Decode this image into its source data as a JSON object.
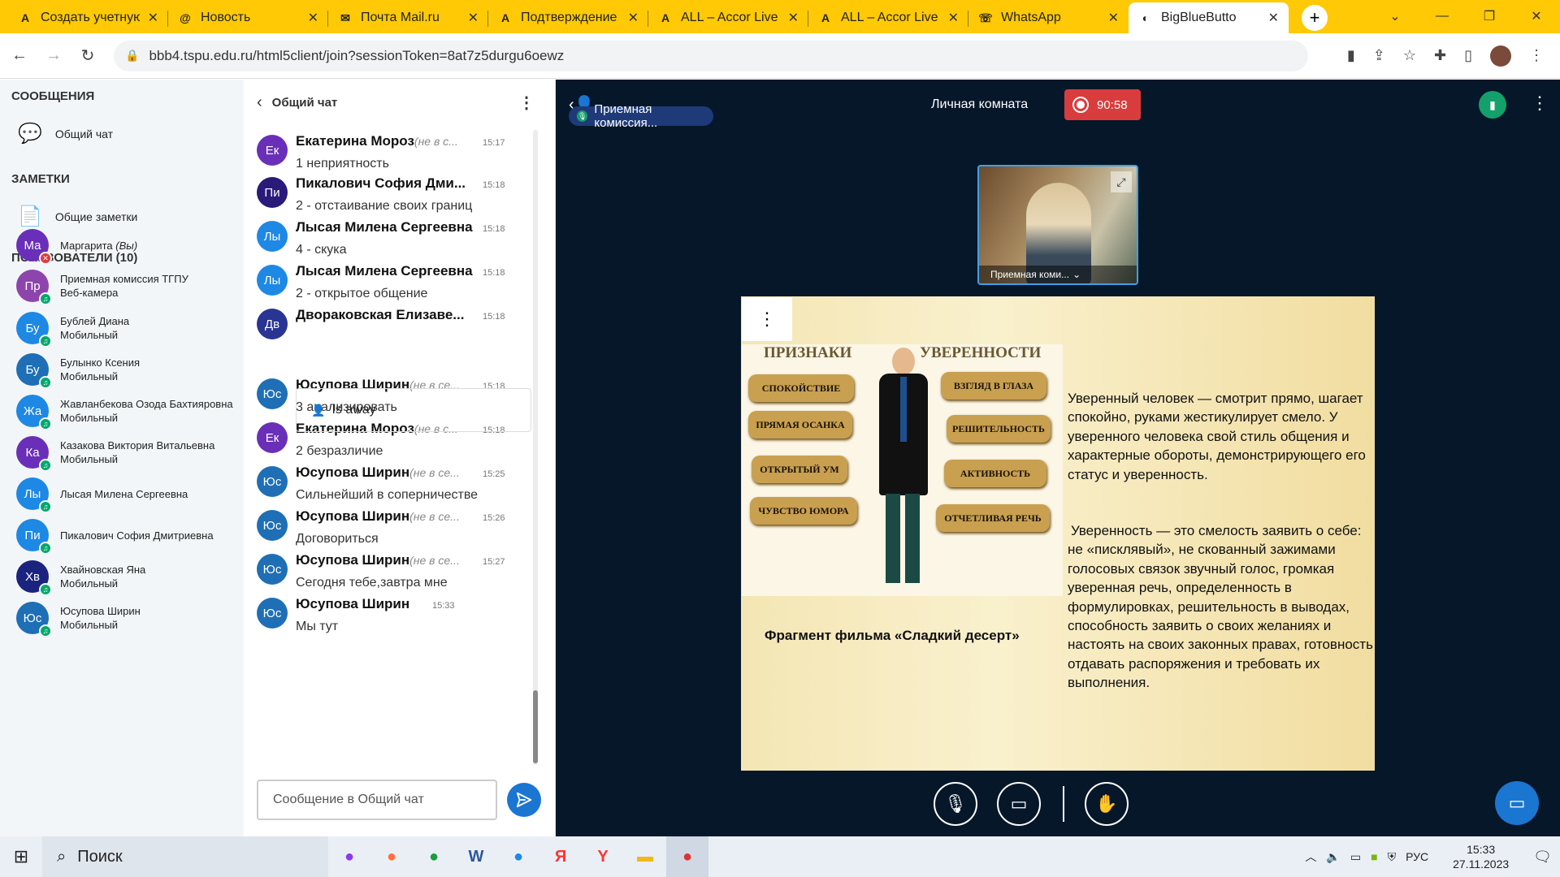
{
  "tabs": [
    {
      "title": "Создать учетную",
      "icon": "A"
    },
    {
      "title": "Новость",
      "icon": "@"
    },
    {
      "title": "Почта Mail.ru",
      "icon": "✉"
    },
    {
      "title": "Подтверждение",
      "icon": "A"
    },
    {
      "title": "ALL – Accor Live",
      "icon": "A"
    },
    {
      "title": "ALL – Accor Live",
      "icon": "A"
    },
    {
      "title": "WhatsApp",
      "icon": "☏"
    },
    {
      "title": "BigBlueButto",
      "icon": "◐"
    }
  ],
  "url": "bbb4.tspu.edu.ru/html5client/join?sessionToken=8at7z5durgu6oewz",
  "left": {
    "messages_header": "СООБЩЕНИЯ",
    "public_chat": "Общий чат",
    "notes_header": "ЗАМЕТКИ",
    "shared_notes": "Общие заметки",
    "users_header": "ПОЛЬЗОВАТЕЛИ (10)",
    "users": [
      {
        "initials": "Ма",
        "name": "Маргарита",
        "suffix": "(Вы)",
        "sub": "",
        "color": "#6a2fb8"
      },
      {
        "initials": "Пр",
        "name": "Приемная комиссия ТГПУ",
        "suffix": "",
        "sub": "Веб-камера",
        "color": "#8e44ad"
      },
      {
        "initials": "Бу",
        "name": "Бублей Диана",
        "suffix": "",
        "sub": "Мобильный",
        "color": "#1e88e5"
      },
      {
        "initials": "Бу",
        "name": "Булынко Ксения",
        "suffix": "",
        "sub": "Мобильный",
        "color": "#1e6fb5"
      },
      {
        "initials": "Жа",
        "name": "Жавланбекова Озода Бахтияровна",
        "suffix": "",
        "sub": "Мобильный",
        "color": "#1e88e5"
      },
      {
        "initials": "Ка",
        "name": "Казакова Виктория Витальевна",
        "suffix": "",
        "sub": "Мобильный",
        "color": "#6a2fb8"
      },
      {
        "initials": "Лы",
        "name": "Лысая Милена Сергеевна",
        "suffix": "",
        "sub": "",
        "color": "#1e88e5"
      },
      {
        "initials": "Пи",
        "name": "Пикалович София Дмитриевна",
        "suffix": "",
        "sub": "",
        "color": "#1e88e5"
      },
      {
        "initials": "Хв",
        "name": "Хвайновская Яна",
        "suffix": "",
        "sub": "Мобильный",
        "color": "#1a237e"
      },
      {
        "initials": "Юс",
        "name": "Юсупова Ширин",
        "suffix": "",
        "sub": "Мобильный",
        "color": "#1e6fb5"
      }
    ]
  },
  "chat": {
    "title": "Общий чат",
    "messages": [
      {
        "initials": "Ек",
        "name": "Екатерина Мороз",
        "status": "(не в с...",
        "time": "15:17",
        "text": "1 неприятность",
        "color": "#6a2fb8"
      },
      {
        "initials": "Пи",
        "name": "Пикалович София Дми...",
        "status": "",
        "time": "15:18",
        "text": "2 - отстаивание своих границ",
        "color": "#2a1a7a"
      },
      {
        "initials": "Лы",
        "name": "Лысая Милена Сергеевна",
        "status": "",
        "time": "15:18",
        "text": "4 - скука",
        "color": "#1e88e5"
      },
      {
        "initials": "Лы",
        "name": "Лысая Милена Сергеевна",
        "status": "",
        "time": "15:18",
        "text": "2 - открытое общение",
        "color": "#1e88e5"
      },
      {
        "initials": "Дв",
        "name": "Двораковская Елизаве...",
        "status": "",
        "time": "15:18",
        "text": "",
        "color": "#283593"
      },
      {
        "initials": "Юс",
        "name": "Юсупова Ширин",
        "status": "(не в се...",
        "time": "15:18",
        "text": "3 анализировать",
        "color": "#1e6fb5"
      },
      {
        "initials": "Ек",
        "name": "Екатерина Мороз",
        "status": "(не в с...",
        "time": "15:18",
        "text": "2 безразличие",
        "color": "#6a2fb8"
      },
      {
        "initials": "Юс",
        "name": "Юсупова Ширин",
        "status": "(не в се...",
        "time": "15:25",
        "text": "Сильнейший в соперничестве",
        "color": "#1e6fb5"
      },
      {
        "initials": "Юс",
        "name": "Юсупова Ширин",
        "status": "(не в се...",
        "time": "15:26",
        "text": "Договориться",
        "color": "#1e6fb5"
      },
      {
        "initials": "Юс",
        "name": "Юсупова Ширин",
        "status": "(не в се...",
        "time": "15:27",
        "text": "Сегодня тебе,завтра мне",
        "color": "#1e6fb5"
      },
      {
        "initials": "Юс",
        "name": "Юсупова Ширин",
        "status": "",
        "time": "15:33",
        "text": "Мы тут",
        "color": "#1e6fb5"
      }
    ],
    "away_label": "Is away",
    "input_placeholder": "Сообщение в Общий чат"
  },
  "meeting": {
    "room": "Личная комната",
    "timer": "90:58",
    "presenter_pill": "Приемная комиссия...",
    "cam_label": "Приемная коми...",
    "slide": {
      "heading_left": "ПРИЗНАКИ",
      "heading_right": "УВЕРЕННОСТИ",
      "pills": [
        "СПОКОЙСТВИЕ",
        "ПРЯМАЯ ОСАНКА",
        "ОТКРЫТЫЙ УМ",
        "ЧУВСТВО ЮМОРА",
        "ВЗГЛЯД В ГЛАЗА",
        "РЕШИТЕЛЬНОСТЬ",
        "АКТИВНОСТЬ",
        "ОТЧЕТЛИВАЯ РЕЧЬ"
      ],
      "caption": "Фрагмент фильма «Сладкий десерт»",
      "p1": "Уверенный человек — смотрит прямо, шагает спокойно, руками жестикулирует смело. У уверенного человека свой стиль общения и характерные обороты, демонстрирующего его статус и уверенность.",
      "p2": "Уверенность — это смелость заявить о себе: не «писклявый», не скованный зажимами голосовых связок звучный голос, громкая уверенная речь, определенность в формулировках, решительность в выводах, способность заявить о своих желаниях и настоять на своих законных правах, готовность отдавать распоряжения и требовать их выполнения."
    }
  },
  "taskbar": {
    "search": "Поиск",
    "lang": "РУС",
    "time": "15:33",
    "date": "27.11.2023"
  }
}
